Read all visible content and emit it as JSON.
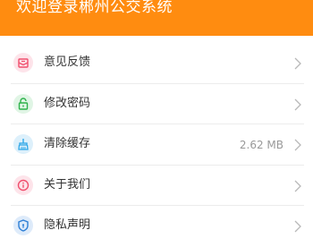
{
  "header": {
    "title": "欢迎登录郴州公交系统",
    "background": "#FF8C10"
  },
  "menu": {
    "items": [
      {
        "label": "意见反馈",
        "icon": "feedback-envelope-icon",
        "icon_color": "#F0506E",
        "icon_bg": "#FDE4EA",
        "value": ""
      },
      {
        "label": "修改密码",
        "icon": "lock-icon",
        "icon_color": "#2DB24B",
        "icon_bg": "#E0F5E5",
        "value": ""
      },
      {
        "label": "清除缓存",
        "icon": "broom-icon",
        "icon_color": "#2EA7E8",
        "icon_bg": "#DDF0FB",
        "value": "2.62 MB"
      },
      {
        "label": "关于我们",
        "icon": "info-icon",
        "icon_color": "#F0506E",
        "icon_bg": "#FDE4EA",
        "value": ""
      },
      {
        "label": "隐私声明",
        "icon": "shield-icon",
        "icon_color": "#2E7FD6",
        "icon_bg": "#DEEBFA",
        "value": ""
      }
    ]
  }
}
